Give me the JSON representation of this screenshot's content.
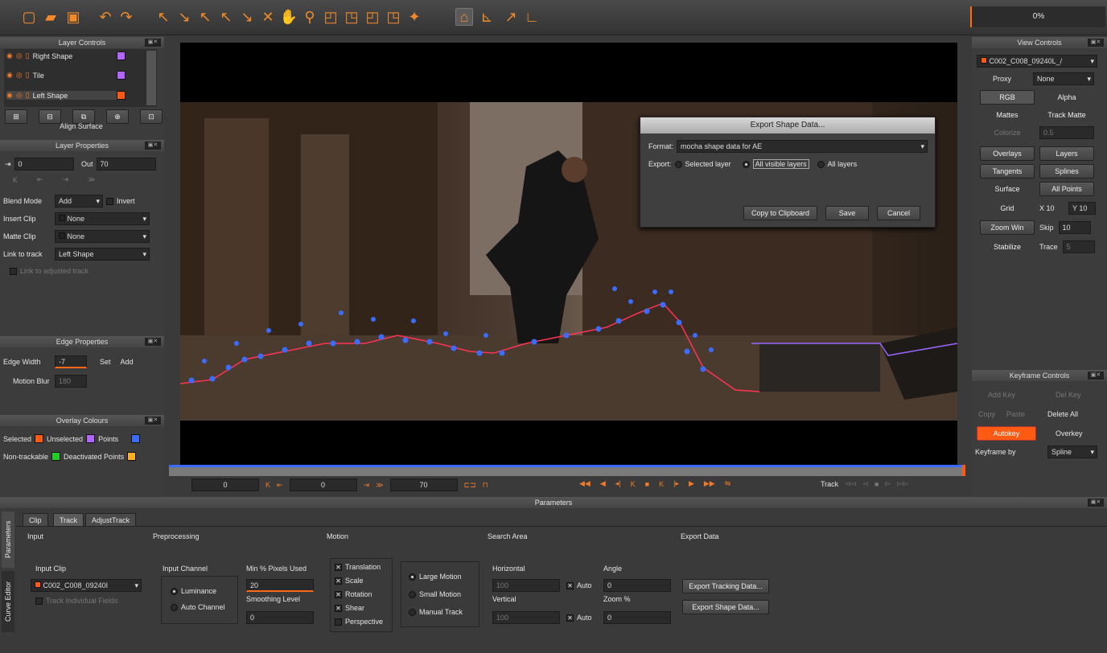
{
  "toolbar": {
    "icons": [
      "new-file-icon",
      "open-folder-icon",
      "save-icon",
      "undo-icon",
      "redo-icon",
      "select-tool-icon",
      "select-points-icon",
      "add-point-icon",
      "add-point-alt-icon",
      "convert-point-icon",
      "move-points-icon",
      "pan-hand-icon",
      "zoom-tool-icon",
      "create-xspline-icon",
      "add-xspline-icon",
      "create-bezier-icon",
      "add-bezier-icon",
      "magnet-icon",
      "show-planar-surface-icon",
      "show-grid-icon",
      "align-surface-icon",
      "tracking-lines-icon"
    ],
    "progress": "0%"
  },
  "layer_controls": {
    "title": "Layer Controls",
    "layers": [
      {
        "name": "Right Shape",
        "color": "#b266ff"
      },
      {
        "name": "Tile",
        "color": "#b266ff"
      },
      {
        "name": "Left Shape",
        "color": "#ff5a14"
      }
    ],
    "align_surface": "Align Surface"
  },
  "layer_properties": {
    "title": "Layer Properties",
    "in_value": "0",
    "out_label": "Out",
    "out_value": "70",
    "blend_mode_label": "Blend Mode",
    "blend_mode": "Add",
    "invert_label": "Invert",
    "insert_clip_label": "Insert Clip",
    "insert_clip": "None",
    "matte_clip_label": "Matte Clip",
    "matte_clip": "None",
    "link_to_track_label": "Link to track",
    "link_to_track": "Left Shape",
    "link_adjusted_label": "Link to adjusted track"
  },
  "edge_properties": {
    "title": "Edge Properties",
    "edge_width_label": "Edge Width",
    "edge_width": "-7",
    "set_label": "Set",
    "add_label": "Add",
    "motion_blur_label": "Motion Blur",
    "motion_blur": "180"
  },
  "overlay_colours": {
    "title": "Overlay Colours",
    "selected_label": "Selected",
    "selected_color": "#ff5a14",
    "unselected_label": "Unselected",
    "unselected_color": "#b266ff",
    "points_label": "Points",
    "points_color": "#3b6cff",
    "nontrackable_label": "Non-trackable",
    "nontrackable_color": "#22cc22",
    "deactivated_label": "Deactivated Points",
    "deactivated_color": "#ffb020"
  },
  "export_dialog": {
    "title": "Export Shape Data...",
    "format_label": "Format:",
    "format_value": "mocha shape data for AE",
    "export_label": "Export:",
    "selected_layer": "Selected layer",
    "all_visible_layers": "All visible layers",
    "all_layers": "All layers",
    "copy_button": "Copy to Clipboard",
    "save_button": "Save",
    "cancel_button": "Cancel"
  },
  "view_controls": {
    "title": "View Controls",
    "clip": "C002_C008_09240L_/",
    "proxy_label": "Proxy",
    "proxy": "None",
    "rgb": "RGB",
    "alpha": "Alpha",
    "mattes": "Mattes",
    "track_matte": "Track Matte",
    "colorize": "Colorize",
    "colorize_value": "0.5",
    "overlays": "Overlays",
    "layers": "Layers",
    "tangents": "Tangents",
    "splines": "Splines",
    "surface": "Surface",
    "all_points": "All Points",
    "grid": "Grid",
    "grid_x": "X 10",
    "grid_y": "Y 10",
    "zoom_win": "Zoom Win",
    "skip_label": "Skip",
    "skip_value": "10",
    "stabilize": "Stabilize",
    "trace_label": "Trace",
    "trace_value": "5"
  },
  "keyframe_controls": {
    "title": "Keyframe Controls",
    "add_key": "Add Key",
    "del_key": "Del Key",
    "copy": "Copy",
    "paste": "Paste",
    "delete_all": "Delete All",
    "autokey": "Autokey",
    "overkey": "Overkey",
    "keyframe_by_label": "Keyframe by",
    "keyframe_by": "Spline"
  },
  "transport": {
    "in_frame": "0",
    "current_frame": "0",
    "out_frame": "70",
    "track_label": "Track"
  },
  "parameters": {
    "title": "Parameters",
    "side_tabs": [
      "Parameters",
      "Curve Editor"
    ],
    "tabs": [
      "Clip",
      "Track",
      "AdjustTrack"
    ],
    "active_tab": "Track",
    "input": {
      "header": "Input",
      "input_clip_label": "Input Clip",
      "input_clip": "C002_C008_09240I",
      "track_fields_label": "Track Individual Fields"
    },
    "preprocessing": {
      "header": "Preprocessing",
      "input_channel_label": "Input Channel",
      "luminance": "Luminance",
      "auto_channel": "Auto Channel",
      "min_pixels_label": "Min % Pixels Used",
      "min_pixels": "20",
      "smoothing_label": "Smoothing Level",
      "smoothing": "0"
    },
    "motion": {
      "header": "Motion",
      "translation": "Translation",
      "scale": "Scale",
      "rotation": "Rotation",
      "shear": "Shear",
      "perspective": "Perspective",
      "large_motion": "Large Motion",
      "small_motion": "Small Motion",
      "manual_track": "Manual Track"
    },
    "search_area": {
      "header": "Search Area",
      "horizontal_label": "Horizontal",
      "horizontal": "100",
      "vertical_label": "Vertical",
      "vertical": "100",
      "auto": "Auto",
      "angle_label": "Angle",
      "angle": "0",
      "zoom_label": "Zoom %",
      "zoom": "0"
    },
    "export_data": {
      "header": "Export Data",
      "export_tracking": "Export Tracking Data...",
      "export_shape": "Export Shape Data..."
    }
  }
}
